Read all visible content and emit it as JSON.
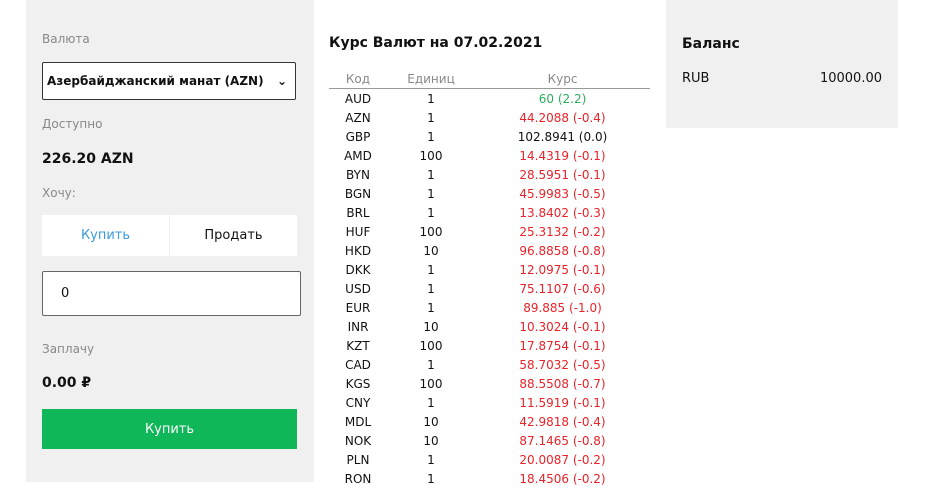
{
  "exchange": {
    "currency_label": "Валюта",
    "currency_selected": "Азербайджанский манат (AZN)",
    "available_label": "Доступно",
    "available_value": "226.20 AZN",
    "want_label": "Хочу:",
    "buy_toggle": "Купить",
    "sell_toggle": "Продать",
    "amount_value": "0",
    "pay_label": "Заплачу",
    "pay_value": "0.00 ₽",
    "submit_label": "Купить"
  },
  "rates": {
    "title": "Курс Валют на 07.02.2021",
    "columns": [
      "Код",
      "Единиц",
      "Курс"
    ],
    "rows": [
      {
        "code": "AUD",
        "units": "1",
        "rate": "60 (2.2)",
        "trend": "up"
      },
      {
        "code": "AZN",
        "units": "1",
        "rate": "44.2088 (-0.4)",
        "trend": "down"
      },
      {
        "code": "GBP",
        "units": "1",
        "rate": "102.8941 (0.0)",
        "trend": "flat"
      },
      {
        "code": "AMD",
        "units": "100",
        "rate": "14.4319 (-0.1)",
        "trend": "down"
      },
      {
        "code": "BYN",
        "units": "1",
        "rate": "28.5951 (-0.1)",
        "trend": "down"
      },
      {
        "code": "BGN",
        "units": "1",
        "rate": "45.9983 (-0.5)",
        "trend": "down"
      },
      {
        "code": "BRL",
        "units": "1",
        "rate": "13.8402 (-0.3)",
        "trend": "down"
      },
      {
        "code": "HUF",
        "units": "100",
        "rate": "25.3132 (-0.2)",
        "trend": "down"
      },
      {
        "code": "HKD",
        "units": "10",
        "rate": "96.8858 (-0.8)",
        "trend": "down"
      },
      {
        "code": "DKK",
        "units": "1",
        "rate": "12.0975 (-0.1)",
        "trend": "down"
      },
      {
        "code": "USD",
        "units": "1",
        "rate": "75.1107 (-0.6)",
        "trend": "down"
      },
      {
        "code": "EUR",
        "units": "1",
        "rate": "89.885 (-1.0)",
        "trend": "down"
      },
      {
        "code": "INR",
        "units": "10",
        "rate": "10.3024 (-0.1)",
        "trend": "down"
      },
      {
        "code": "KZT",
        "units": "100",
        "rate": "17.8754 (-0.1)",
        "trend": "down"
      },
      {
        "code": "CAD",
        "units": "1",
        "rate": "58.7032 (-0.5)",
        "trend": "down"
      },
      {
        "code": "KGS",
        "units": "100",
        "rate": "88.5508 (-0.7)",
        "trend": "down"
      },
      {
        "code": "CNY",
        "units": "1",
        "rate": "11.5919 (-0.1)",
        "trend": "down"
      },
      {
        "code": "MDL",
        "units": "10",
        "rate": "42.9818 (-0.4)",
        "trend": "down"
      },
      {
        "code": "NOK",
        "units": "10",
        "rate": "87.1465 (-0.8)",
        "trend": "down"
      },
      {
        "code": "PLN",
        "units": "1",
        "rate": "20.0087 (-0.2)",
        "trend": "down"
      },
      {
        "code": "RON",
        "units": "1",
        "rate": "18.4506 (-0.2)",
        "trend": "down"
      }
    ]
  },
  "balance": {
    "title": "Баланс",
    "currency": "RUB",
    "amount": "10000.00"
  },
  "colors": {
    "accent_blue": "#3b9bdc",
    "buy_green": "#10b759",
    "rate_up": "#2eae5c",
    "rate_down": "#e8232a",
    "panel_bg": "#f0f0f0"
  },
  "icons": {
    "select_chevron": "chevron-down-icon"
  }
}
